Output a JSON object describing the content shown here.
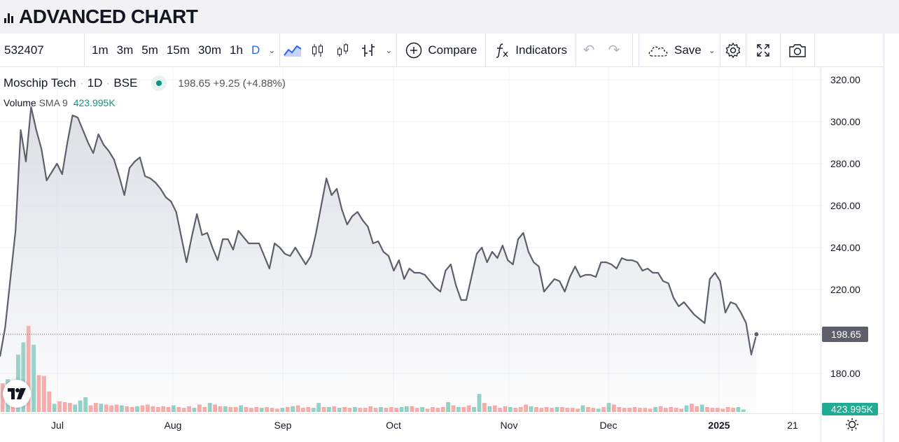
{
  "header": {
    "title": "ADVANCED CHART",
    "logo_icon": "bar-chart-icon"
  },
  "toolbar": {
    "symbol": "532407",
    "timeframes": [
      "1m",
      "3m",
      "5m",
      "15m",
      "30m",
      "1h",
      "D"
    ],
    "active_timeframe": "D",
    "compare_label": "Compare",
    "indicators_label": "Indicators",
    "save_label": "Save"
  },
  "legend": {
    "name": "Moschip Tech",
    "interval": "1D",
    "exchange": "BSE",
    "price": "198.65",
    "change": "+9.25",
    "change_pct": "(+4.88%)",
    "volume_label": "Volume",
    "sma_label": "SMA 9",
    "volume_value": "423.995K"
  },
  "colors": {
    "line": "#5d606b",
    "up": "#089981",
    "down": "#f23645",
    "accent": "#2962ff"
  },
  "chart_data": {
    "type": "area",
    "x_ticks": [
      "Jul",
      "Aug",
      "Sep",
      "Oct",
      "Nov",
      "Dec",
      "2025",
      "21"
    ],
    "y_ticks": [
      "320.00",
      "300.00",
      "280.00",
      "260.00",
      "240.00",
      "220.00",
      "180.00"
    ],
    "ylim": [
      180,
      320
    ],
    "last_price_label": "198.65",
    "last_volume_label": "423.995K",
    "series": [
      {
        "values": [
          188,
          202,
          225,
          248,
          296,
          281,
          307,
          296,
          287,
          272,
          276,
          280,
          275,
          290,
          303,
          302,
          296,
          290,
          285,
          294,
          289,
          286,
          282,
          274,
          265,
          278,
          281,
          283,
          274,
          273,
          271,
          268,
          264,
          262,
          257,
          245,
          233,
          245,
          256,
          246,
          247,
          240,
          234,
          244,
          244,
          239,
          248,
          245,
          242,
          242,
          242,
          236,
          230,
          242,
          240,
          237,
          236,
          240,
          236,
          232,
          236,
          247,
          260,
          273,
          265,
          268,
          258,
          251,
          255,
          257,
          253,
          250,
          242,
          243,
          238,
          236,
          229,
          234,
          225,
          230,
          228,
          228,
          227,
          224,
          221,
          219,
          229,
          232,
          222,
          215,
          215,
          226,
          237,
          240,
          233,
          238,
          235,
          241,
          234,
          232,
          244,
          247,
          238,
          233,
          231,
          219,
          222,
          225,
          224,
          219,
          226,
          231,
          226,
          227,
          227,
          226,
          233,
          233,
          232,
          230,
          235,
          234,
          234,
          233,
          229,
          230,
          228,
          228,
          224,
          223,
          216,
          212,
          214,
          211,
          208,
          206,
          204,
          225,
          228,
          224,
          209,
          214,
          213,
          209,
          204,
          189,
          198.65
        ]
      }
    ],
    "volume": [
      {
        "v": 35,
        "up": false
      },
      {
        "v": 40,
        "up": true
      },
      {
        "v": 38,
        "up": false
      },
      {
        "v": 70,
        "up": true
      },
      {
        "v": 85,
        "up": true
      },
      {
        "v": 105,
        "up": false
      },
      {
        "v": 82,
        "up": true
      },
      {
        "v": 45,
        "up": false
      },
      {
        "v": 44,
        "up": false
      },
      {
        "v": 25,
        "up": false
      },
      {
        "v": 10,
        "up": true
      },
      {
        "v": 13,
        "up": false
      },
      {
        "v": 12,
        "up": false
      },
      {
        "v": 11,
        "up": false
      },
      {
        "v": 9,
        "up": true
      },
      {
        "v": 14,
        "up": true
      },
      {
        "v": 18,
        "up": true
      },
      {
        "v": 8,
        "up": false
      },
      {
        "v": 11,
        "up": false
      },
      {
        "v": 10,
        "up": true
      },
      {
        "v": 9,
        "up": false
      },
      {
        "v": 8,
        "up": false
      },
      {
        "v": 9,
        "up": false
      },
      {
        "v": 8,
        "up": true
      },
      {
        "v": 7,
        "up": false
      },
      {
        "v": 6,
        "up": false
      },
      {
        "v": 7,
        "up": true
      },
      {
        "v": 8,
        "up": false
      },
      {
        "v": 9,
        "up": false
      },
      {
        "v": 7,
        "up": false
      },
      {
        "v": 6,
        "up": false
      },
      {
        "v": 7,
        "up": false
      },
      {
        "v": 6,
        "up": false
      },
      {
        "v": 8,
        "up": true
      },
      {
        "v": 6,
        "up": false
      },
      {
        "v": 5,
        "up": false
      },
      {
        "v": 7,
        "up": false
      },
      {
        "v": 5,
        "up": true
      },
      {
        "v": 9,
        "up": false
      },
      {
        "v": 6,
        "up": false
      },
      {
        "v": 11,
        "up": true
      },
      {
        "v": 9,
        "up": false
      },
      {
        "v": 7,
        "up": false
      },
      {
        "v": 7,
        "up": true
      },
      {
        "v": 6,
        "up": false
      },
      {
        "v": 6,
        "up": false
      },
      {
        "v": 8,
        "up": true
      },
      {
        "v": 6,
        "up": false
      },
      {
        "v": 5,
        "up": false
      },
      {
        "v": 6,
        "up": false
      },
      {
        "v": 5,
        "up": true
      },
      {
        "v": 6,
        "up": false
      },
      {
        "v": 5,
        "up": false
      },
      {
        "v": 4,
        "up": false
      },
      {
        "v": 5,
        "up": true
      },
      {
        "v": 6,
        "up": false
      },
      {
        "v": 7,
        "up": true
      },
      {
        "v": 8,
        "up": false
      },
      {
        "v": 5,
        "up": false
      },
      {
        "v": 6,
        "up": false
      },
      {
        "v": 5,
        "up": true
      },
      {
        "v": 11,
        "up": true
      },
      {
        "v": 6,
        "up": false
      },
      {
        "v": 6,
        "up": true
      },
      {
        "v": 7,
        "up": false
      },
      {
        "v": 5,
        "up": true
      },
      {
        "v": 6,
        "up": false
      },
      {
        "v": 5,
        "up": false
      },
      {
        "v": 6,
        "up": true
      },
      {
        "v": 5,
        "up": false
      },
      {
        "v": 5,
        "up": false
      },
      {
        "v": 7,
        "up": false
      },
      {
        "v": 5,
        "up": false
      },
      {
        "v": 6,
        "up": true
      },
      {
        "v": 5,
        "up": false
      },
      {
        "v": 6,
        "up": false
      },
      {
        "v": 5,
        "up": false
      },
      {
        "v": 6,
        "up": true
      },
      {
        "v": 7,
        "up": true
      },
      {
        "v": 7,
        "up": false
      },
      {
        "v": 5,
        "up": false
      },
      {
        "v": 6,
        "up": true
      },
      {
        "v": 4,
        "up": false
      },
      {
        "v": 6,
        "up": false
      },
      {
        "v": 5,
        "up": false
      },
      {
        "v": 6,
        "up": false
      },
      {
        "v": 12,
        "up": true
      },
      {
        "v": 8,
        "up": false
      },
      {
        "v": 6,
        "up": true
      },
      {
        "v": 6,
        "up": false
      },
      {
        "v": 8,
        "up": false
      },
      {
        "v": 6,
        "up": true
      },
      {
        "v": 22,
        "up": true
      },
      {
        "v": 11,
        "up": false
      },
      {
        "v": 7,
        "up": true
      },
      {
        "v": 8,
        "up": false
      },
      {
        "v": 5,
        "up": false
      },
      {
        "v": 7,
        "up": false
      },
      {
        "v": 6,
        "up": true
      },
      {
        "v": 5,
        "up": false
      },
      {
        "v": 6,
        "up": false
      },
      {
        "v": 9,
        "up": false
      },
      {
        "v": 7,
        "up": true
      },
      {
        "v": 6,
        "up": false
      },
      {
        "v": 5,
        "up": false
      },
      {
        "v": 6,
        "up": false
      },
      {
        "v": 5,
        "up": false
      },
      {
        "v": 6,
        "up": true
      },
      {
        "v": 6,
        "up": false
      },
      {
        "v": 5,
        "up": false
      },
      {
        "v": 5,
        "up": false
      },
      {
        "v": 4,
        "up": false
      },
      {
        "v": 8,
        "up": true
      },
      {
        "v": 6,
        "up": false
      },
      {
        "v": 5,
        "up": false
      },
      {
        "v": 4,
        "up": true
      },
      {
        "v": 6,
        "up": false
      },
      {
        "v": 11,
        "up": true
      },
      {
        "v": 9,
        "up": false
      },
      {
        "v": 6,
        "up": false
      },
      {
        "v": 5,
        "up": false
      },
      {
        "v": 5,
        "up": false
      },
      {
        "v": 6,
        "up": false
      },
      {
        "v": 5,
        "up": false
      },
      {
        "v": 5,
        "up": false
      },
      {
        "v": 4,
        "up": false
      },
      {
        "v": 6,
        "up": true
      },
      {
        "v": 7,
        "up": false
      },
      {
        "v": 5,
        "up": false
      },
      {
        "v": 6,
        "up": false
      },
      {
        "v": 5,
        "up": false
      },
      {
        "v": 4,
        "up": false
      },
      {
        "v": 8,
        "up": true
      },
      {
        "v": 10,
        "up": false
      },
      {
        "v": 7,
        "up": false
      },
      {
        "v": 9,
        "up": true
      },
      {
        "v": 6,
        "up": false
      },
      {
        "v": 5,
        "up": false
      },
      {
        "v": 5,
        "up": false
      },
      {
        "v": 4,
        "up": false
      },
      {
        "v": 6,
        "up": false
      },
      {
        "v": 5,
        "up": false
      },
      {
        "v": 6,
        "up": true
      },
      {
        "v": 3,
        "up": true
      }
    ]
  }
}
